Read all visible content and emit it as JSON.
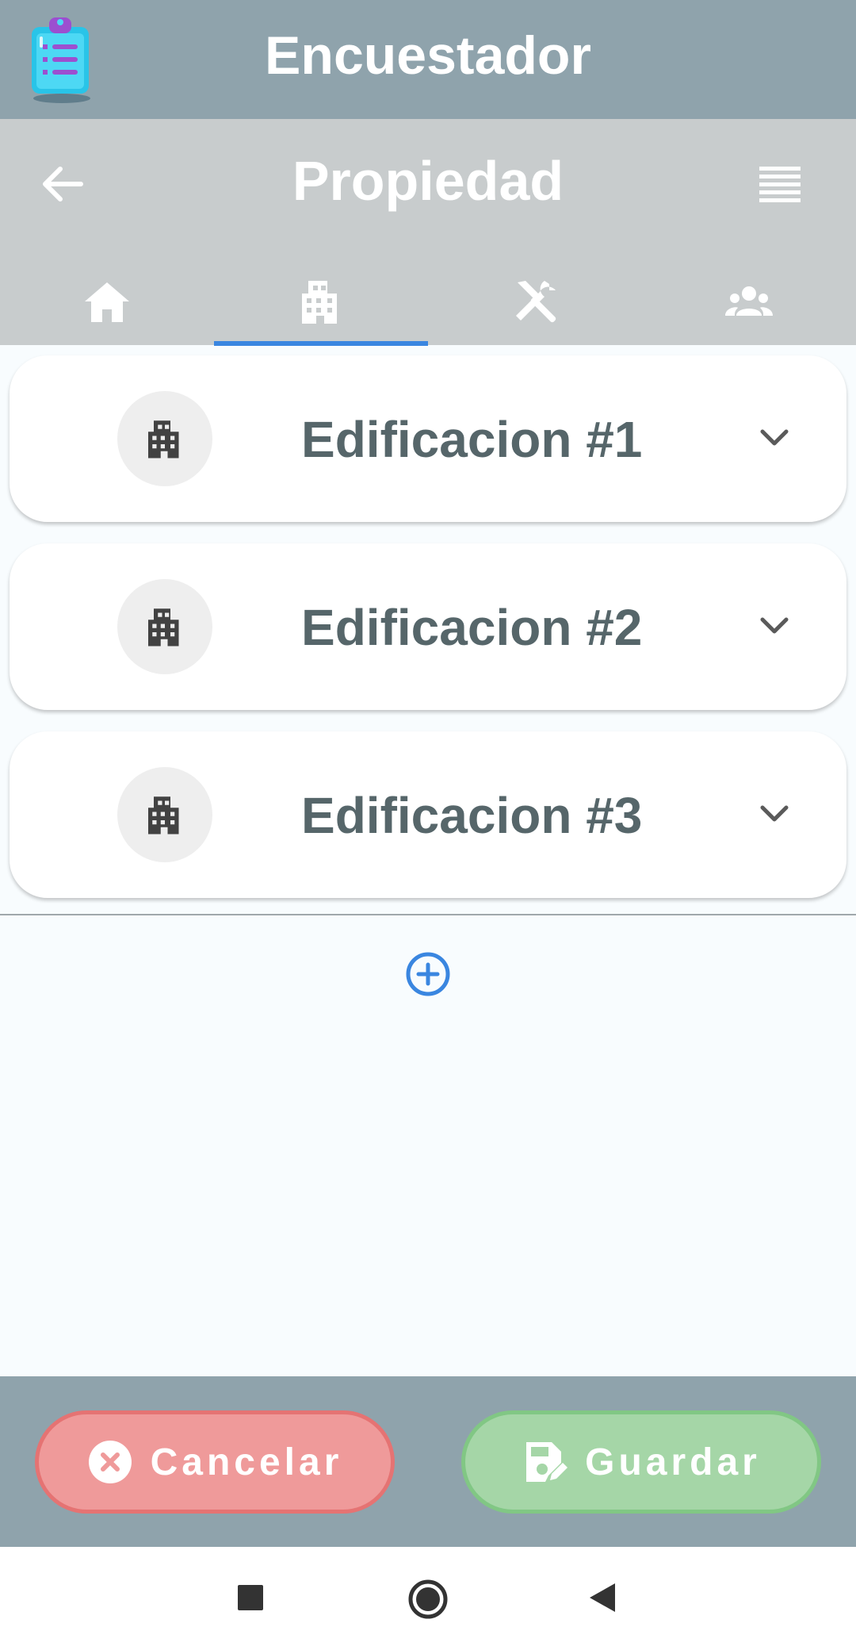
{
  "app": {
    "title": "Encuestador"
  },
  "header": {
    "title": "Propiedad"
  },
  "tabs": [
    {
      "icon": "home-icon",
      "active": false
    },
    {
      "icon": "building-icon",
      "active": true
    },
    {
      "icon": "tools-icon",
      "active": false
    },
    {
      "icon": "people-icon",
      "active": false
    }
  ],
  "buildings": [
    {
      "label": "Edificacion #1"
    },
    {
      "label": "Edificacion #2"
    },
    {
      "label": "Edificacion #3"
    }
  ],
  "actions": {
    "cancel_label": "Cancelar",
    "save_label": "Guardar"
  },
  "colors": {
    "header_bg": "#8fa3ac",
    "subheader_bg": "#c8cccd",
    "accent": "#3a86e0",
    "cancel": "#ef9a9a",
    "save": "#a5d6a7",
    "card_text": "#56666a"
  }
}
